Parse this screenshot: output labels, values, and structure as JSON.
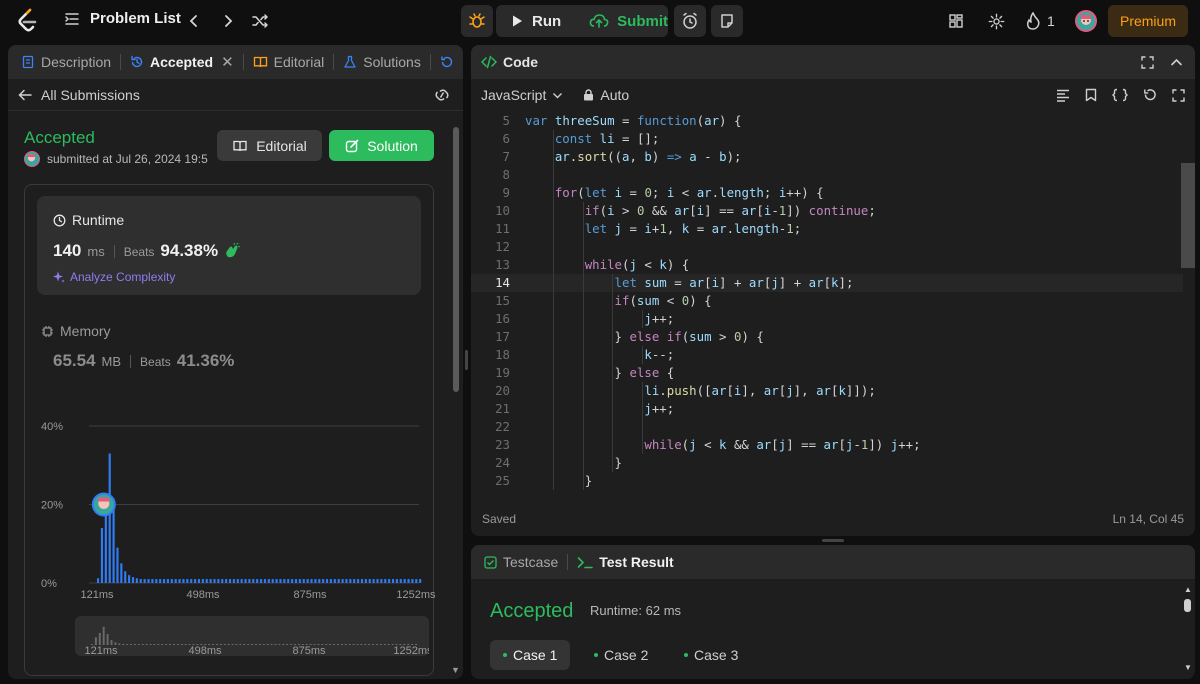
{
  "topbar": {
    "problem_list": "Problem List",
    "run_label": "Run",
    "submit_label": "Submit",
    "streak_count": "1",
    "premium_label": "Premium"
  },
  "left_tabs": {
    "description": "Description",
    "accepted": "Accepted",
    "editorial": "Editorial",
    "solutions": "Solutions"
  },
  "submission": {
    "back_label": "All Submissions",
    "status": "Accepted",
    "submitted_at": "submitted at Jul 26, 2024 19:5",
    "editorial_button": "Editorial",
    "solution_button": "Solution"
  },
  "runtime": {
    "label": "Runtime",
    "value": "140",
    "unit": "ms",
    "beats_label": "Beats",
    "beats_pct": "94.38%",
    "analyze_label": "Analyze Complexity"
  },
  "memory": {
    "label": "Memory",
    "value": "65.54",
    "unit": "MB",
    "beats_label": "Beats",
    "beats_pct": "41.36%"
  },
  "chart_data": {
    "type": "bar",
    "y_ticks": [
      "40%",
      "20%",
      "0%"
    ],
    "ylim": [
      0,
      40
    ],
    "x_ticks": [
      "121ms",
      "498ms",
      "875ms",
      "1252ms"
    ],
    "values": [
      1.2,
      14,
      22,
      33,
      20,
      9,
      5,
      3,
      2,
      1.5,
      1.2,
      1,
      1,
      1,
      1,
      1,
      1,
      1,
      1,
      1,
      1,
      1,
      1,
      1,
      1,
      1,
      1,
      1,
      1,
      1,
      1,
      1,
      1,
      1,
      1,
      1,
      1,
      1,
      1,
      1,
      1,
      1,
      1,
      1,
      1,
      1,
      1,
      1,
      1,
      1,
      1,
      1,
      1,
      1,
      1,
      1,
      1,
      1,
      1,
      1,
      1,
      1,
      1,
      1,
      1,
      1,
      1,
      1,
      1,
      1,
      1,
      1,
      1,
      1,
      1,
      1,
      1,
      1,
      1,
      1,
      1,
      1,
      1,
      1
    ],
    "highlight_index": 2,
    "highlight_value": 20
  },
  "code_header": {
    "title": "Code",
    "language": "JavaScript",
    "mode": "Auto"
  },
  "code_lines": [
    {
      "n": "5",
      "t": "var threeSum = function(ar) {"
    },
    {
      "n": "6",
      "t": "    const li = [];"
    },
    {
      "n": "7",
      "t": "    ar.sort((a, b) => a - b);"
    },
    {
      "n": "8",
      "t": ""
    },
    {
      "n": "9",
      "t": "    for(let i = 0; i < ar.length; i++) {"
    },
    {
      "n": "10",
      "t": "        if(i > 0 && ar[i] == ar[i-1]) continue;"
    },
    {
      "n": "11",
      "t": "        let j = i+1, k = ar.length-1;"
    },
    {
      "n": "12",
      "t": ""
    },
    {
      "n": "13",
      "t": "        while(j < k) {"
    },
    {
      "n": "14",
      "t": "            let sum = ar[i] + ar[j] + ar[k];"
    },
    {
      "n": "15",
      "t": "            if(sum < 0) {"
    },
    {
      "n": "16",
      "t": "                j++;"
    },
    {
      "n": "17",
      "t": "            } else if(sum > 0) {"
    },
    {
      "n": "18",
      "t": "                k--;"
    },
    {
      "n": "19",
      "t": "            } else {"
    },
    {
      "n": "20",
      "t": "                li.push([ar[i], ar[j], ar[k]]);"
    },
    {
      "n": "21",
      "t": "                j++;"
    },
    {
      "n": "22",
      "t": ""
    },
    {
      "n": "23",
      "t": "                while(j < k && ar[j] == ar[j-1]) j++;"
    },
    {
      "n": "24",
      "t": "            }"
    },
    {
      "n": "25",
      "t": "        }"
    }
  ],
  "code_status": {
    "saved": "Saved",
    "position": "Ln 14, Col 45"
  },
  "result": {
    "testcase_tab": "Testcase",
    "test_result_tab": "Test Result",
    "status": "Accepted",
    "runtime": "Runtime: 62 ms",
    "cases": [
      "Case 1",
      "Case 2",
      "Case 3"
    ]
  },
  "colors": {
    "accent_green": "#2cbb5d",
    "premium_orange": "#ffa116",
    "bar_blue": "#2e7df6"
  }
}
